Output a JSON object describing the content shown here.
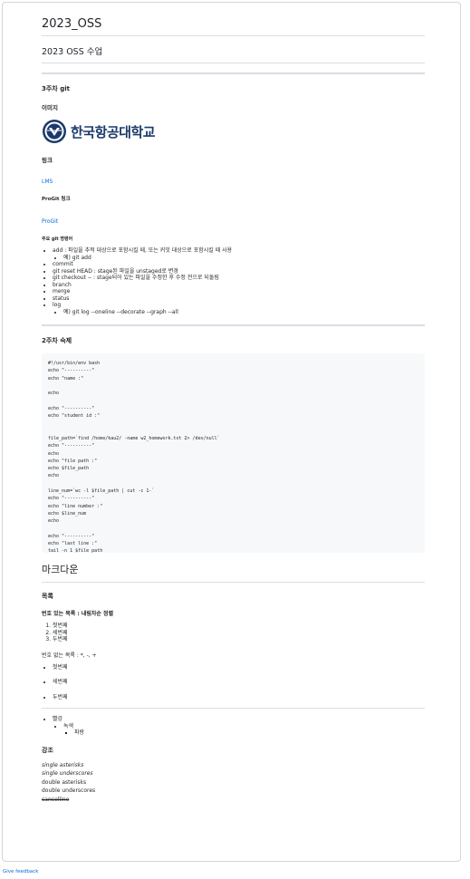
{
  "title": "2023_OSS",
  "subtitle": "2023 OSS 수업",
  "week3": {
    "heading": "3주차 git",
    "image_heading": "이미지",
    "logo_text": "한국항공대학교",
    "link_heading": "링크",
    "lms_link": "LMS",
    "progit_heading": "ProGit 링크",
    "progit_link": "ProGit",
    "commands_heading": "주요 git 명령어",
    "commands": [
      {
        "text": "add : 파일을 추적 대상으로 포함시킬 때, 또는 커밋 대상으로 포함시킬 때 사용",
        "sub": [
          "예) git add"
        ]
      },
      {
        "text": "commit",
        "sub": []
      },
      {
        "text": "git reset HEAD : stage된 파일을 unstaged로 변경",
        "sub": []
      },
      {
        "text": "git checkout -- : stage되어 있는 파일을 수정한 후 수정 전으로 되돌림",
        "sub": []
      },
      {
        "text": "branch",
        "sub": []
      },
      {
        "text": "merge",
        "sub": []
      },
      {
        "text": "status",
        "sub": []
      },
      {
        "text": "log",
        "sub": [
          "예) git log --oneline --decorate --graph --all"
        ]
      }
    ]
  },
  "week2": {
    "heading": "2주차 숙제",
    "code": "#!/usr/bin/env bash\necho \"----------\"\necho \"name :\"\n\necho\n\necho \"----------\"\necho \"student id :\"\n\n\nfile_path=`find /home/kau2/ -name w2_homework.txt 2> /dev/null`\necho \"----------\"\necho\necho \"file path :\"\necho $file_path\necho\n\nline_num=`wc -l $file_path | cut -c 1-`\necho \"----------\"\necho \"line number :\"\necho $line_num\necho\n\necho \"----------\"\necho \"last line :\"\ntail -n 1 $file_path"
  },
  "markdown": {
    "heading": "마크다운",
    "list_heading": "목록",
    "ordered_heading": "번호 있는 목록 : 내림차순 정렬",
    "ordered": [
      "첫번째",
      "세번째",
      "두번째"
    ],
    "unordered_heading": "번호 없는 목록 : *, -, +",
    "unordered": [
      "첫번째",
      "세번째",
      "두번째"
    ],
    "nested": {
      "l1": "빨강",
      "l2": "녹색",
      "l3": "파랑"
    },
    "emphasis_heading": "강조",
    "emphasis": {
      "single_asterisks": "single asterisks",
      "single_underscores": "single underscores",
      "double_asterisks": "double asterisks",
      "double_underscores": "double underscores",
      "cancelline": "cancelline"
    }
  },
  "footer": {
    "feedback": "Give feedback"
  }
}
